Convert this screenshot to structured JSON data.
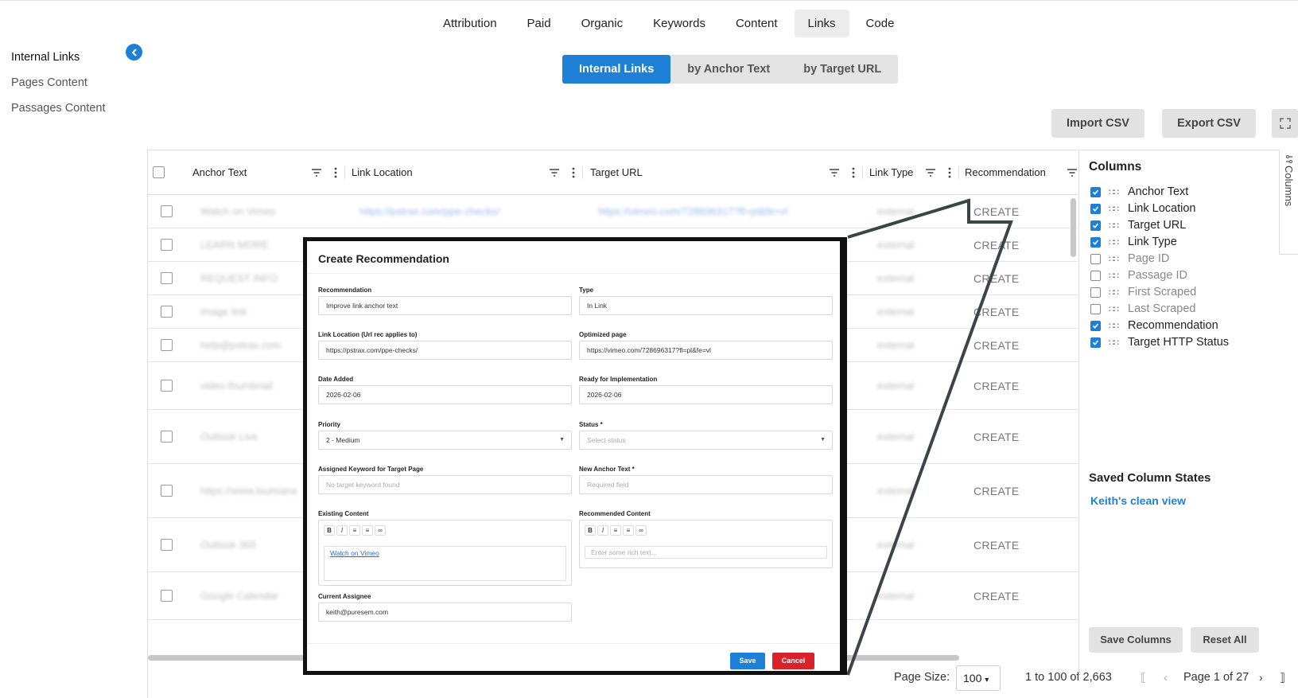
{
  "top_nav": [
    "Attribution",
    "Paid",
    "Organic",
    "Keywords",
    "Content",
    "Links",
    "Code"
  ],
  "top_nav_active": "Links",
  "sidebar": {
    "items": [
      {
        "label": "Internal Links",
        "active": true
      },
      {
        "label": "Pages Content",
        "active": false
      },
      {
        "label": "Passages Content",
        "active": false
      }
    ]
  },
  "segment": {
    "options": [
      "Internal Links",
      "by Anchor Text",
      "by Target URL"
    ],
    "active": "Internal Links"
  },
  "actions": {
    "import_csv": "Import CSV",
    "export_csv": "Export CSV"
  },
  "grid": {
    "headers": [
      "Anchor Text",
      "Link Location",
      "Target URL",
      "Link Type",
      "Recommendation"
    ],
    "rows": [
      {
        "anchor": "Watch on Vimeo",
        "location": "https://pstrax.com/ppe-checks/",
        "target": "https://vimeo.com/728696317?fl=pl&fe=vl",
        "type": "external",
        "rec": "CREATE"
      },
      {
        "anchor": "LEARN MORE",
        "location": "",
        "target": "",
        "type": "external",
        "rec": "CREATE"
      },
      {
        "anchor": "REQUEST INFO",
        "location": "",
        "target": "",
        "type": "external",
        "rec": "CREATE"
      },
      {
        "anchor": "image link",
        "location": "",
        "target": "",
        "type": "external",
        "rec": "CREATE"
      },
      {
        "anchor": "help@pstrax.com",
        "location": "",
        "target": "",
        "type": "external",
        "rec": "CREATE"
      },
      {
        "anchor": "video thumbnail",
        "location": "",
        "target": "",
        "type": "external",
        "rec": "CREATE"
      },
      {
        "anchor": "Outlook Live",
        "location": "",
        "target": "",
        "type": "external",
        "rec": "CREATE"
      },
      {
        "anchor": "https://www.louisiana",
        "location": "",
        "target": "",
        "type": "external",
        "rec": "CREATE"
      },
      {
        "anchor": "Outlook 365",
        "location": "",
        "target": "",
        "type": "external",
        "rec": "CREATE"
      },
      {
        "anchor": "Google Calendar",
        "location": "",
        "target": "",
        "type": "external",
        "rec": "CREATE"
      }
    ]
  },
  "footer": {
    "page_size_label": "Page Size:",
    "page_size": "100",
    "range": "1 to 100 of 2,663",
    "page": "Page 1 of 27"
  },
  "columns_panel": {
    "title": "Columns",
    "tab_label": "Columns",
    "items": [
      {
        "label": "Anchor Text",
        "checked": true
      },
      {
        "label": "Link Location",
        "checked": true
      },
      {
        "label": "Target URL",
        "checked": true
      },
      {
        "label": "Link Type",
        "checked": true
      },
      {
        "label": "Page ID",
        "checked": false
      },
      {
        "label": "Passage ID",
        "checked": false
      },
      {
        "label": "First Scraped",
        "checked": false
      },
      {
        "label": "Last Scraped",
        "checked": false
      },
      {
        "label": "Recommendation",
        "checked": true
      },
      {
        "label": "Target HTTP Status",
        "checked": true
      }
    ],
    "saved_title": "Saved Column States",
    "saved_link": "Keith's clean view",
    "save_button": "Save Columns",
    "reset_button": "Reset All"
  },
  "modal": {
    "title": "Create Recommendation",
    "recommendation_label": "Recommendation",
    "recommendation_value": "Improve link anchor text",
    "type_label": "Type",
    "type_value": "In Link",
    "link_location_label": "Link Location (Url rec applies to)",
    "link_location_value": "https://pstrax.com/ppe-checks/",
    "optimized_page_label": "Optimized page",
    "optimized_page_value": "https://vimeo.com/728696317?fl=pl&fe=vl",
    "date_added_label": "Date Added",
    "date_added_value": "2026-02-06",
    "ready_label": "Ready for Implementation",
    "ready_value": "2026-02-06",
    "priority_label": "Priority",
    "priority_value": "2 - Medium",
    "status_label": "Status *",
    "status_placeholder": "Select status",
    "keyword_label": "Assigned Keyword for Target Page",
    "keyword_placeholder": "No target keyword found",
    "new_anchor_label": "New Anchor Text *",
    "new_anchor_placeholder": "Required field",
    "existing_content_label": "Existing Content",
    "existing_content_value": "Watch on Vimeo",
    "recommended_content_label": "Recommended Content",
    "recommended_content_placeholder": "Enter some rich text...",
    "assignee_label": "Current Assignee",
    "assignee_value": "keith@puresem.com",
    "save": "Save",
    "cancel": "Cancel"
  },
  "colors": {
    "accent": "#1e7fd6",
    "cancel": "#d9232b",
    "save": "#1e7fd6"
  }
}
